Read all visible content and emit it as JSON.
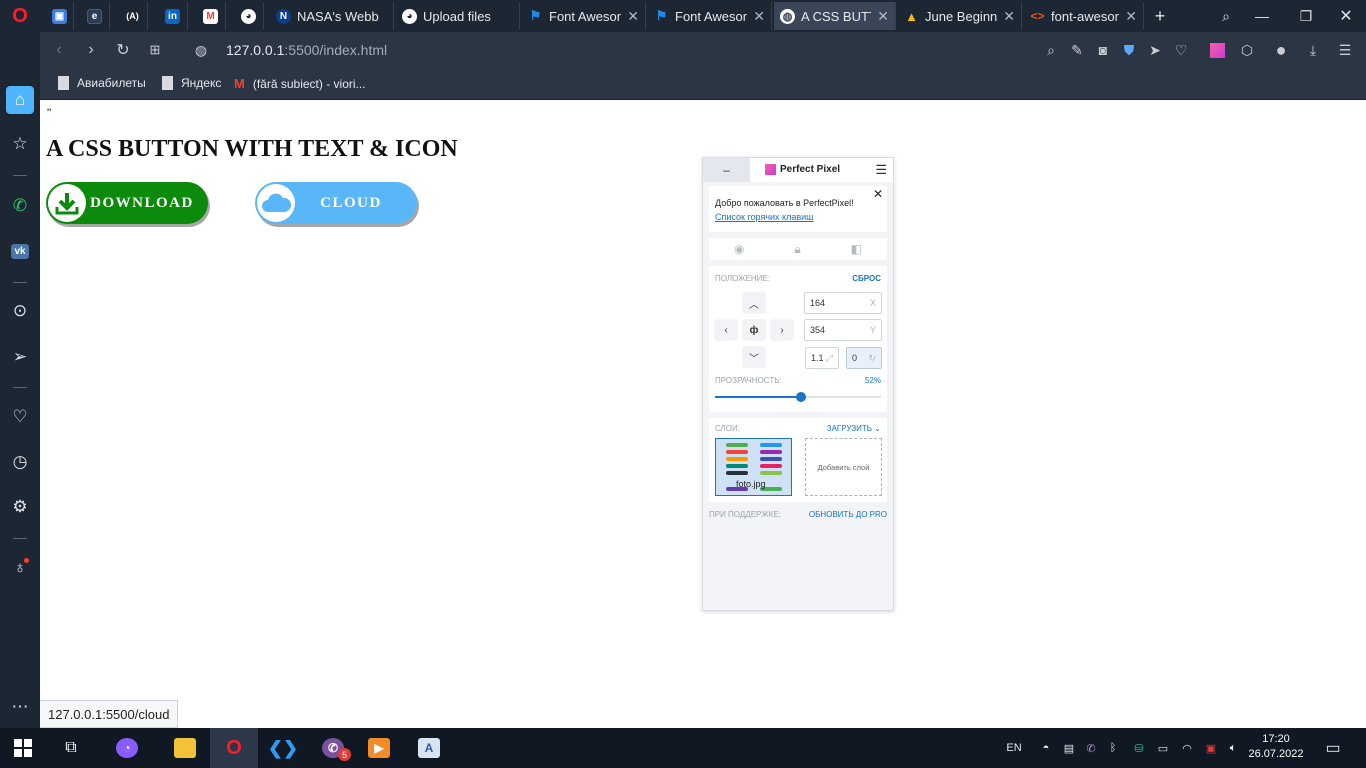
{
  "browser": {
    "tabs": [
      {
        "title": "",
        "fav": "user-contact-icon",
        "color": "#3b7dd8"
      },
      {
        "title": "",
        "fav": "ebook-icon",
        "color": "#2b3b58"
      },
      {
        "title": "",
        "fav": "angular-icon",
        "color": "#1d2633"
      },
      {
        "title": "",
        "fav": "linkedin-icon",
        "color": "#0a66c2"
      },
      {
        "title": "",
        "fav": "gmail-icon",
        "color": "#ea4335"
      },
      {
        "title": "",
        "fav": "github-icon",
        "color": "#1d2633"
      },
      {
        "title": "NASA's Webb",
        "fav": "nasa-icon",
        "color": "#0b3d91"
      },
      {
        "title": "Upload files",
        "fav": "github-icon",
        "color": "#1d2633"
      },
      {
        "title": "Font Awesom",
        "fav": "font-awesome-flag-icon",
        "color": "#228ae6"
      },
      {
        "title": "Font Awesom",
        "fav": "font-awesome-flag-icon",
        "color": "#228ae6"
      },
      {
        "title": "A CSS BUTTO",
        "fav": "page-globe-icon",
        "color": "#6c7a8d"
      },
      {
        "title": "June Beginne",
        "fav": "google-drive-icon",
        "color": "#1fa463"
      },
      {
        "title": "font-awesom",
        "fav": "code-icon",
        "color": "#e8542b"
      }
    ],
    "url_host": "127.0.0.1",
    "url_rest": ":5500/index.html",
    "bookmarks": [
      {
        "label": "Авиабилеты",
        "icon": "page-icon"
      },
      {
        "label": "Яндекс",
        "icon": "page-icon"
      },
      {
        "label": "(fără subiect) - viori...",
        "icon": "gmail-icon"
      }
    ],
    "status_url": "127.0.0.1:5500/cloud"
  },
  "page": {
    "quote": "\"",
    "heading": "A CSS BUTTON WITH TEXT & ICON",
    "download_label": "DOWNLOAD",
    "cloud_label": "CLOUD",
    "download_color": "#0b8a0b",
    "cloud_color": "#5ab7f7"
  },
  "perfectpixel": {
    "min": "–",
    "title": "Perfect Pixel",
    "welcome": "Добро пожаловать в PerfectPixel!",
    "hotkeys": "Список горячих клавиш",
    "position_label": "ПОЛОЖЕНИЕ:",
    "reset": "СБРОС",
    "x": "164",
    "x_unit": "X",
    "y": "354",
    "y_unit": "Y",
    "scale": "1.1",
    "rotation": "0",
    "center": "ф",
    "opacity_label": "ПРОЗРАЧНОСТЬ:",
    "opacity": "52%",
    "opacity_value": 0.52,
    "layers_label": "СЛОИ:",
    "upload": "ЗАГРУЗИТЬ",
    "layer_name": "foto.jpg",
    "add_layer": "Добавить слой",
    "support": "ПРИ ПОДДЕРЖКЕ:",
    "pro": "ОБНОВИТЬ ДО PRO"
  },
  "taskbar": {
    "lang": "EN",
    "time": "17:20",
    "date": "26.07.2022",
    "viber_badge": "5"
  }
}
